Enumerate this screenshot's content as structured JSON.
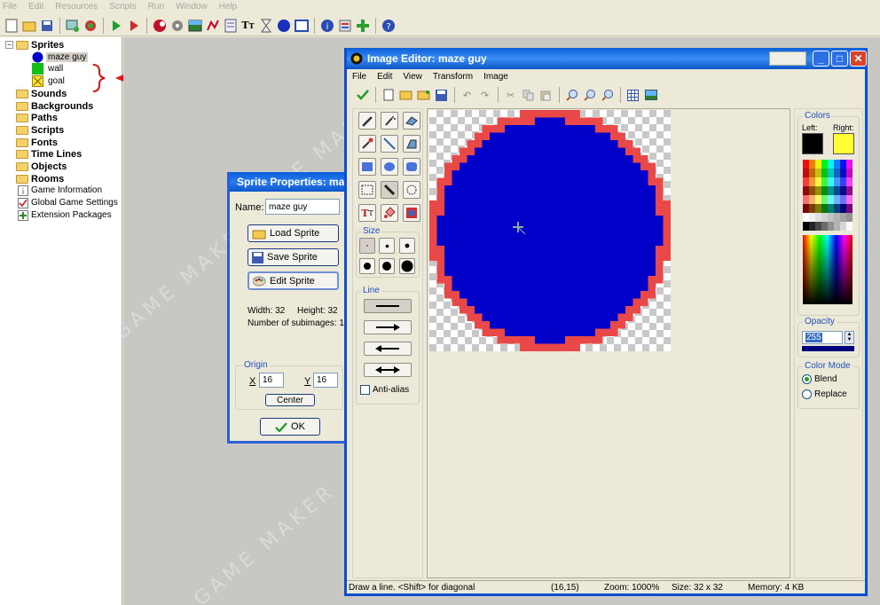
{
  "main_menu": [
    "File",
    "Edit",
    "Resources",
    "Scripts",
    "Run",
    "Window",
    "Help"
  ],
  "tree": {
    "sprites": "Sprites",
    "sprite_items": [
      "maze guy",
      "wall",
      "goal"
    ],
    "folders": [
      "Sounds",
      "Backgrounds",
      "Paths",
      "Scripts",
      "Fonts",
      "Time Lines",
      "Objects",
      "Rooms"
    ],
    "extras": [
      "Game Information",
      "Global Game Settings",
      "Extension Packages"
    ]
  },
  "sprite_props": {
    "title": "Sprite Properties: maz",
    "name_label": "Name:",
    "name_value": "maze guy",
    "load": "Load Sprite",
    "save": "Save Sprite",
    "edit": "Edit Sprite",
    "width": "Width: 32",
    "height": "Height: 32",
    "subimages": "Number of subimages: 1",
    "origin": "Origin",
    "x_label": "X",
    "x_value": "16",
    "y_label": "Y",
    "y_value": "16",
    "center": "Center",
    "ok": "OK"
  },
  "image_editor": {
    "title": "Image Editor: maze guy",
    "menu": [
      "File",
      "Edit",
      "View",
      "Transform",
      "Image"
    ],
    "size_label": "Size",
    "line_label": "Line",
    "antialias": "Anti-alias",
    "colors_label": "Colors",
    "left_label": "Left:",
    "right_label": "Right:",
    "left_color": "#000000",
    "right_color": "#ffff33",
    "opacity_label": "Opacity",
    "opacity_value": "255",
    "color_mode_label": "Color Mode",
    "blend": "Blend",
    "replace": "Replace",
    "sprite_fill": "#0000c8",
    "sprite_outline": "#e84848"
  },
  "status": {
    "hint": "Draw a line. <Shift> for diagonal",
    "coords": "(16,15)",
    "zoom": "Zoom: 1000%",
    "size": "Size: 32 x 32",
    "memory": "Memory: 4 KB"
  }
}
